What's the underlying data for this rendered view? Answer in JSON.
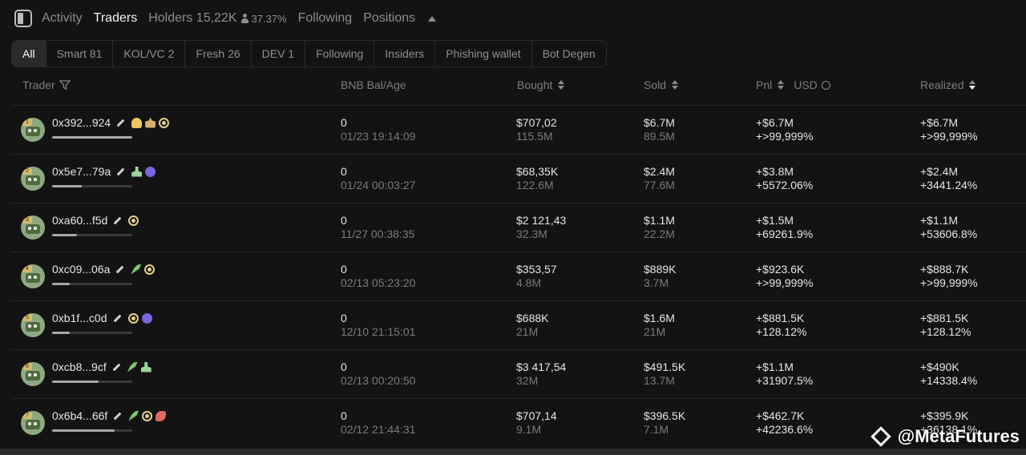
{
  "top_tabs": {
    "activity": "Activity",
    "traders": "Traders",
    "holders_label": "Holders",
    "holders_count": "15,22K",
    "holders_pct": "37.37%",
    "following": "Following",
    "positions": "Positions"
  },
  "filters": [
    {
      "label": "All",
      "active": true
    },
    {
      "label": "Smart 81"
    },
    {
      "label": "KOL/VC 2"
    },
    {
      "label": "Fresh 26"
    },
    {
      "label": "DEV 1"
    },
    {
      "label": "Following"
    },
    {
      "label": "Insiders"
    },
    {
      "label": "Phishing wallet"
    },
    {
      "label": "Bot Degen"
    }
  ],
  "columns": {
    "trader": "Trader",
    "bal": "BNB Bal/Age",
    "bought": "Bought",
    "sold": "Sold",
    "pnl": "Pnl",
    "usd": "USD",
    "realized": "Realized"
  },
  "rows": [
    {
      "rank": "1",
      "addr": "0x392...924",
      "tags": [
        "chef",
        "group",
        "target"
      ],
      "bar": 1.0,
      "bal": "0",
      "age": "01/23 19:14:09",
      "bought": "$707,02",
      "bought_amt": "115.5M",
      "sold": "$6.7M",
      "sold_amt": "89.5M",
      "pnl": "+$6.7M",
      "pnl_pct": "+>99,999%",
      "realized": "+$6.7M",
      "realized_pct": "+>99,999%"
    },
    {
      "rank": "2",
      "addr": "0x5e7...79a",
      "tags": [
        "user",
        "bot"
      ],
      "bar": 0.37,
      "bal": "0",
      "age": "01/24 00:03:27",
      "bought": "$68,35K",
      "bought_amt": "122.6M",
      "sold": "$2.4M",
      "sold_amt": "77.6M",
      "pnl": "+$3.8M",
      "pnl_pct": "+5572.06%",
      "realized": "+$2.4M",
      "realized_pct": "+3441.24%"
    },
    {
      "rank": "3",
      "addr": "0xa60...f5d",
      "tags": [
        "target"
      ],
      "bar": 0.31,
      "bal": "0",
      "age": "11/27 00:38:35",
      "bought": "$2 121,43",
      "bought_amt": "32.3M",
      "sold": "$1.1M",
      "sold_amt": "22.2M",
      "pnl": "+$1.5M",
      "pnl_pct": "+69261.9%",
      "realized": "+$1.1M",
      "realized_pct": "+53606.8%"
    },
    {
      "rank": "4",
      "addr": "0xc09...06a",
      "tags": [
        "leaf",
        "target"
      ],
      "bar": 0.22,
      "bal": "0",
      "age": "02/13 05:23:20",
      "bought": "$353,57",
      "bought_amt": "4.8M",
      "sold": "$889K",
      "sold_amt": "3.7M",
      "pnl": "+$923.6K",
      "pnl_pct": "+>99,999%",
      "realized": "+$888.7K",
      "realized_pct": "+>99,999%"
    },
    {
      "rank": "5",
      "addr": "0xb1f...c0d",
      "tags": [
        "target",
        "bot"
      ],
      "bar": 0.22,
      "bal": "0",
      "age": "12/10 21:15:01",
      "bought": "$688K",
      "bought_amt": "21M",
      "sold": "$1.6M",
      "sold_amt": "21M",
      "pnl": "+$881.5K",
      "pnl_pct": "+128.12%",
      "realized": "+$881.5K",
      "realized_pct": "+128.12%"
    },
    {
      "rank": "6",
      "addr": "0xcb8...9cf",
      "tags": [
        "leaf",
        "user"
      ],
      "bar": 0.58,
      "bal": "0",
      "age": "02/13 00:20:50",
      "bought": "$3 417,54",
      "bought_amt": "32M",
      "sold": "$491.5K",
      "sold_amt": "13.7M",
      "pnl": "+$1.1M",
      "pnl_pct": "+31907.5%",
      "realized": "+$490K",
      "realized_pct": "+14338.4%"
    },
    {
      "rank": "7",
      "addr": "0x6b4...66f",
      "tags": [
        "leaf",
        "target",
        "fish"
      ],
      "bar": 0.78,
      "bal": "0",
      "age": "02/12 21:44:31",
      "bought": "$707,14",
      "bought_amt": "9.1M",
      "sold": "$396.5K",
      "sold_amt": "7.1M",
      "pnl": "+$462.7K",
      "pnl_pct": "+42236.6%",
      "realized": "+$395.9K",
      "realized_pct": "+36138.1%"
    }
  ],
  "watermark": "@MetaFutures"
}
